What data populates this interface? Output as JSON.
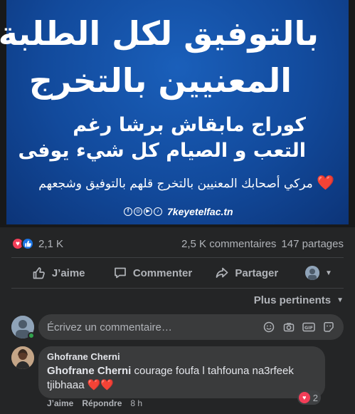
{
  "image": {
    "line1": "بالتوفيق لكل الطلبة",
    "line2": "المعنيين بالتخرج",
    "line3": "كوراج مابقاش برشا رغم",
    "line4": "التعب و الصيام كل شيء يوفى",
    "line5": "مركي أصحابك المعنيين بالتخرج قلهم بالتوفيق وشجعهم",
    "line5_emoji": "❤️",
    "brand": "7keyetelfac.tn",
    "social_icons": [
      "f",
      "ig",
      "yt",
      "tw"
    ]
  },
  "stats": {
    "reaction_count": "2,1 K",
    "comments": "2,5 K commentaires",
    "shares": "147 partages"
  },
  "actions": {
    "like": "J’aime",
    "comment": "Commenter",
    "share": "Partager"
  },
  "sort": {
    "label": "Plus pertinents"
  },
  "composer": {
    "placeholder": "Écrivez un commentaire…"
  },
  "comment": {
    "author": "Ghofrane Cherni",
    "tag": "Ghofrane Cherni",
    "text": " courage foufa l tahfouna na3rfeek tjibhaaa ",
    "hearts": "❤️❤️",
    "reaction_count": "2",
    "like": "J’aime",
    "reply": "Répondre",
    "time": "8 h"
  },
  "colors": {
    "background": "#242526",
    "bubble": "#3a3b3c",
    "text": "#e4e6eb",
    "muted": "#b0b3b8",
    "poster_blue": "#124a9c",
    "love": "#f33e58",
    "like": "#1b74e4"
  }
}
